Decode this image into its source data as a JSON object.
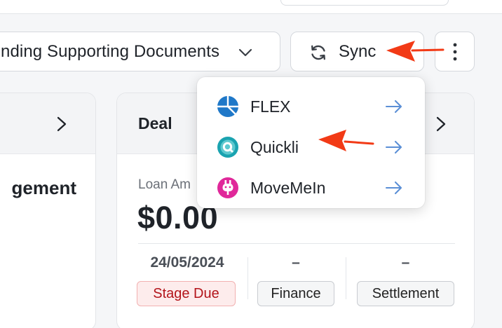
{
  "toolbar": {
    "status_select_label": "nding Supporting Documents",
    "sync_label": "Sync"
  },
  "sync_menu": {
    "items": [
      {
        "label": "FLEX",
        "icon": "flex-logo-icon",
        "color": "#1f78c8"
      },
      {
        "label": "Quickli",
        "icon": "quickli-logo-icon",
        "color": "#1aa3b0"
      },
      {
        "label": "MoveMeIn",
        "icon": "movemein-logo-icon",
        "color": "#e0289a"
      }
    ]
  },
  "left_card": {
    "title_fragment": "gement"
  },
  "deal_card": {
    "title": "Deal",
    "loan_label": "Loan Am",
    "loan_amount": "$0.00",
    "columns": [
      {
        "value": "24/05/2024",
        "tag": "Stage Due"
      },
      {
        "value": "–",
        "tag": "Finance"
      },
      {
        "value": "–",
        "tag": "Settlement"
      }
    ]
  },
  "colors": {
    "annotation_arrow": "#f23a16",
    "menu_arrow": "#5b8fd6",
    "stage_due": "#b3141a"
  }
}
